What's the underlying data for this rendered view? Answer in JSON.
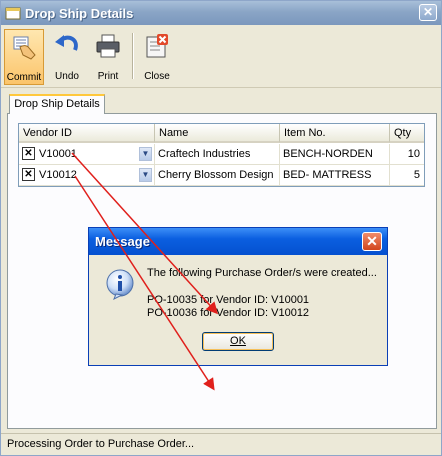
{
  "window": {
    "title": "Drop Ship Details"
  },
  "toolbar": {
    "commit_label": "Commit",
    "undo_label": "Undo",
    "print_label": "Print",
    "close_label": "Close"
  },
  "tab": {
    "label": "Drop Ship Details"
  },
  "grid": {
    "headers": {
      "vendor_id": "Vendor ID",
      "name": "Name",
      "item_no": "Item No.",
      "qty": "Qty"
    },
    "rows": [
      {
        "vendor_id": "V10001",
        "name": "Craftech Industries",
        "item_no": "BENCH-NORDEN",
        "qty": "10"
      },
      {
        "vendor_id": "V10012",
        "name": "Cherry Blossom Design",
        "item_no": "BED- MATTRESS",
        "qty": "5"
      }
    ]
  },
  "dialog": {
    "title": "Message",
    "line1": "The following Purchase Order/s were created...",
    "line2": "PO-10035 for Vendor ID: V10001",
    "line3": "PO-10036 for Vendor ID: V10012",
    "ok_label": "OK"
  },
  "status": {
    "text": "Processing Order to Purchase Order..."
  },
  "colors": {
    "annotation_arrow": "#e0201c",
    "dialog_title": "#0b5fe0"
  }
}
